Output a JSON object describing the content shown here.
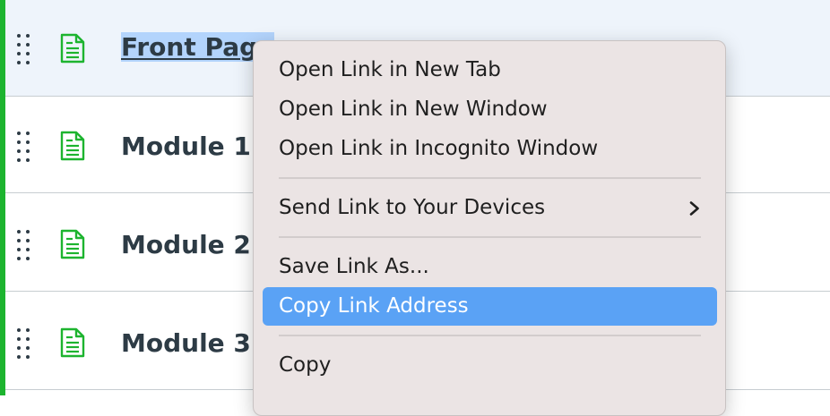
{
  "modules": [
    {
      "title": "Front Page",
      "selected": true
    },
    {
      "title": "Module 1:",
      "selected": false
    },
    {
      "title": "Module 2:",
      "selected": false
    },
    {
      "title": "Module 3:",
      "selected": false
    }
  ],
  "icons": {
    "drag": "drag-handle-icon",
    "page": "page-icon",
    "submenu": "chevron-right-icon"
  },
  "colors": {
    "accent_bar": "#1db42f",
    "page_icon": "#1db42f",
    "title_text": "#2d3b45",
    "selected_row_bg": "#eef4fb",
    "text_highlight": "#b3d4fc",
    "menu_bg": "#ebe4e4",
    "menu_active": "#5aa2f5"
  },
  "context_menu": {
    "items": [
      {
        "label": "Open Link in New Tab"
      },
      {
        "label": "Open Link in New Window"
      },
      {
        "label": "Open Link in Incognito Window"
      },
      {
        "label": "Send Link to Your Devices",
        "has_submenu": true
      },
      {
        "label": "Save Link As..."
      },
      {
        "label": "Copy Link Address",
        "active": true
      },
      {
        "label": "Copy"
      }
    ]
  }
}
